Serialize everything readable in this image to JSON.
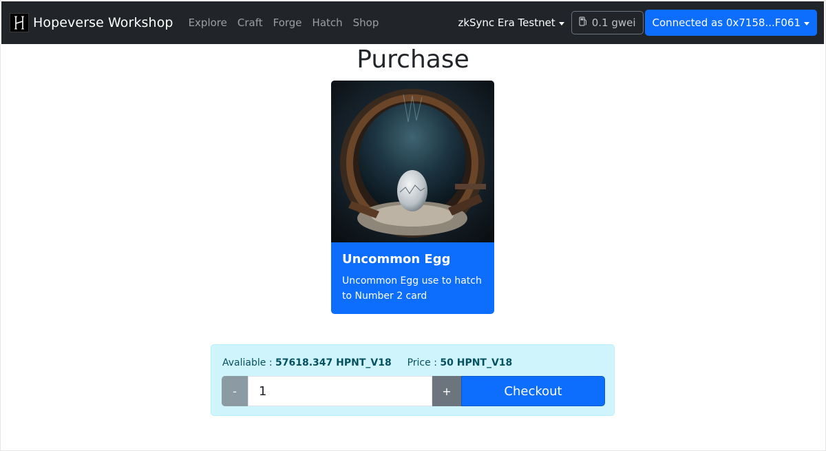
{
  "navbar": {
    "brand": "Hopeverse Workshop",
    "links": [
      "Explore",
      "Craft",
      "Forge",
      "Hatch",
      "Shop"
    ],
    "network": "zkSync Era Testnet",
    "gas": "0.1 gwei",
    "connect": "Connected as 0x7158...F061"
  },
  "page": {
    "title": "Purchase"
  },
  "card": {
    "title": "Uncommon Egg",
    "description": "Uncommon Egg use to hatch to Number 2 card"
  },
  "purchase": {
    "available_label": "Avaliable :",
    "available_value": "57618.347 HPNT_V18",
    "price_label": "Price :",
    "price_value": "50 HPNT_V18",
    "minus": "-",
    "quantity": "1",
    "plus": "+",
    "checkout": "Checkout"
  },
  "colors": {
    "navbar": "#212529",
    "primary": "#0d6efd",
    "info_bg": "#cff4fc",
    "minus_btn": "#8c9aa3",
    "plus_btn": "#6c757d"
  },
  "icons": {
    "brand": "hopeverse-logo-icon",
    "gas": "gas-pump-icon",
    "dropdown": "caret-down-icon"
  }
}
